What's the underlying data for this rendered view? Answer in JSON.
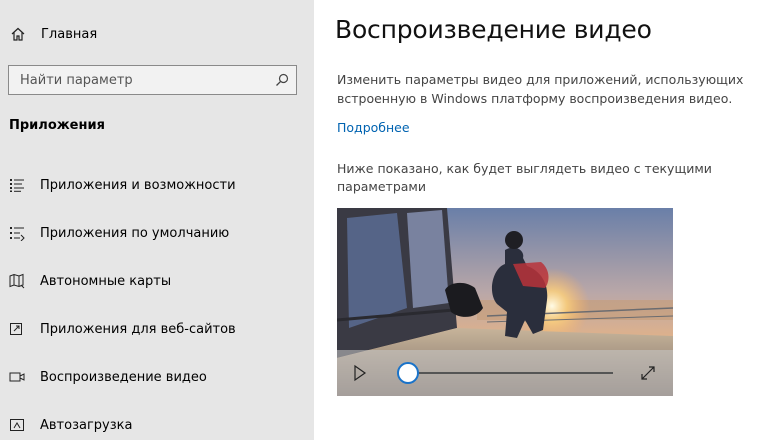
{
  "sidebar": {
    "home_label": "Главная",
    "search_placeholder": "Найти параметр",
    "section_title": "Приложения",
    "items": [
      {
        "label": "Приложения и возможности",
        "icon": "apps-list-icon"
      },
      {
        "label": "Приложения по умолчанию",
        "icon": "default-apps-icon"
      },
      {
        "label": "Автономные карты",
        "icon": "offline-maps-icon"
      },
      {
        "label": "Приложения для веб-сайтов",
        "icon": "apps-for-websites-icon"
      },
      {
        "label": "Воспроизведение видео",
        "icon": "video-playback-icon",
        "active": true
      },
      {
        "label": "Автозагрузка",
        "icon": "startup-icon"
      }
    ]
  },
  "main": {
    "title": "Воспроизведение видео",
    "description": "Изменить параметры видео для приложений, использующих встроенную в Windows платформу воспроизведения видео.",
    "more_link": "Подробнее",
    "preview_text": "Ниже показано, как будет выглядеть видео с текущими параметрами",
    "video": {
      "progress": 0.0
    }
  },
  "colors": {
    "sidebar_bg": "#e6e6e6",
    "accent": "#0063b1",
    "slider_thumb_border": "#1a73c9"
  }
}
